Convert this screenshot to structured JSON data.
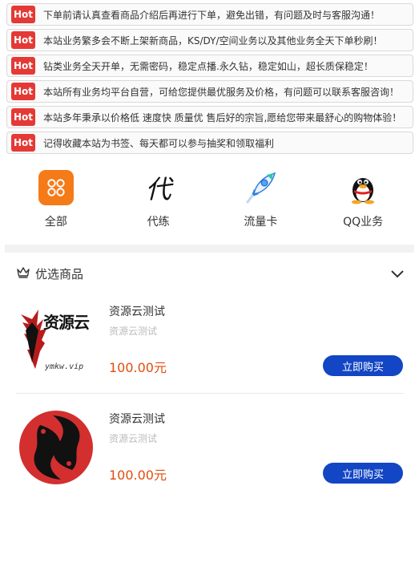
{
  "notices": [
    {
      "badge": "Hot",
      "text": "下单前请认真查看商品介绍后再进行下单，避免出错，有问题及时与客服沟通！"
    },
    {
      "badge": "Hot",
      "text": "本站业务繁多会不断上架新商品，KS/DY/空间业务以及其他业务全天下单秒刷！"
    },
    {
      "badge": "Hot",
      "text": "钻类业务全天开单，无需密码，稳定点播.永久钻，稳定如山，超长质保稳定！"
    },
    {
      "badge": "Hot",
      "text": "本站所有业务均平台自营，可给您提供最优服务及价格，有问题可以联系客服咨询！"
    },
    {
      "badge": "Hot",
      "text": "本站多年秉承以价格低 速度快 质量优 售后好的宗旨,愿给您带来最舒心的购物体验！"
    },
    {
      "badge": "Hot",
      "text": "记得收藏本站为书签、每天都可以参与抽奖和领取福利"
    }
  ],
  "categories": [
    {
      "label": "全部",
      "icon": "grid-icon"
    },
    {
      "label": "代练",
      "icon": "dai-character-icon",
      "glyph": "代"
    },
    {
      "label": "流量卡",
      "icon": "rocket-icon"
    },
    {
      "label": "QQ业务",
      "icon": "qq-penguin-icon"
    }
  ],
  "section": {
    "title": "优选商品",
    "icon": "crown-icon"
  },
  "products": [
    {
      "name": "资源云测试",
      "desc": "资源云测试",
      "price": "100.00元",
      "button": "立即购买",
      "logo_text": "资源云",
      "logo_subtext": "ymkw.vip"
    },
    {
      "name": "资源云测试",
      "desc": "资源云测试",
      "price": "100.00元",
      "button": "立即购买"
    }
  ],
  "colors": {
    "hot": "#e53935",
    "accent": "#f57a18",
    "button": "#1346c4",
    "price": "#e04d0d"
  }
}
